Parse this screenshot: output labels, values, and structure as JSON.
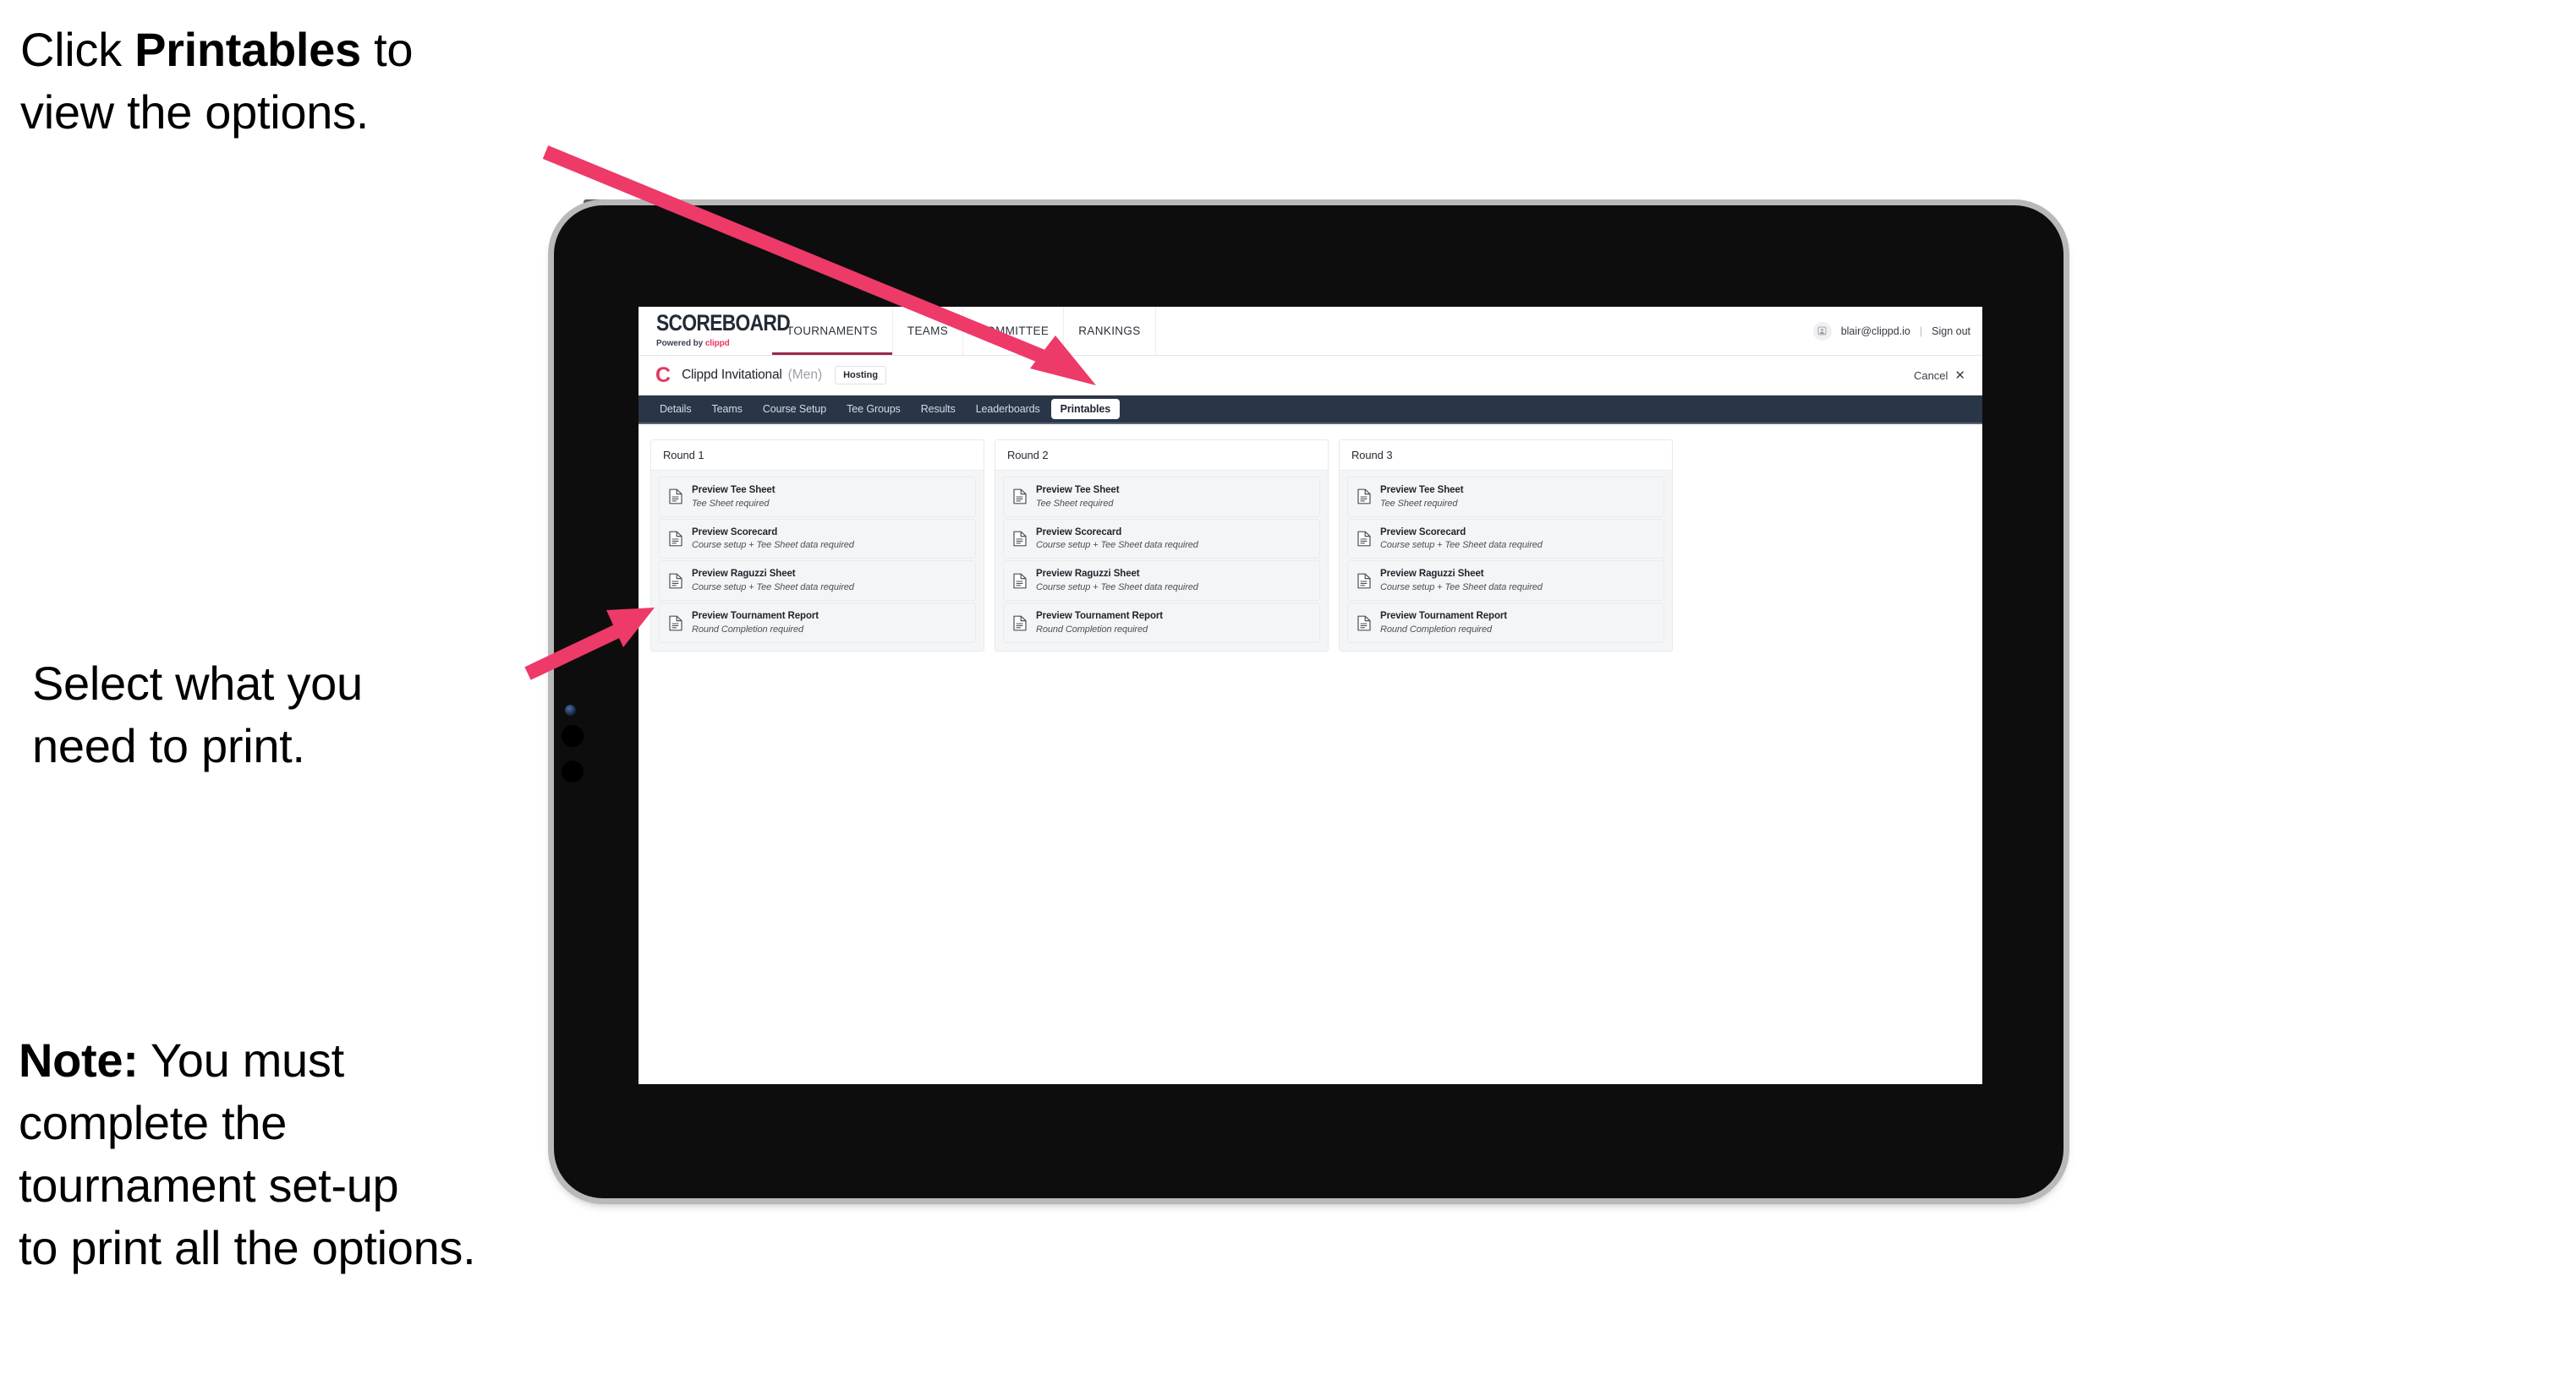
{
  "annotations": {
    "printables_prefix": "Click ",
    "printables_bold": "Printables",
    "printables_suffix": " to\nview the options.",
    "select_text": "Select what you\n need to print.",
    "note_bold": "Note:",
    "note_text": " You must\ncomplete the\ntournament set-up\nto print all the options.",
    "arrow_color": "#ED3A68"
  },
  "app": {
    "brand": {
      "title": "SCOREBOARD",
      "powered_prefix": "Powered by ",
      "powered_brand": "clippd"
    },
    "nav": [
      {
        "label": "TOURNAMENTS",
        "active": true
      },
      {
        "label": "TEAMS",
        "active": false
      },
      {
        "label": "COMMITTEE",
        "active": false
      },
      {
        "label": "RANKINGS",
        "active": false
      }
    ],
    "user": {
      "avatar_icon": "user-avatar-icon",
      "email": "blair@clippd.io",
      "separator": "|",
      "sign_out": "Sign out"
    },
    "tournament": {
      "logo_letter": "C",
      "name": "Clippd Invitational",
      "gender": "(Men)",
      "badge": "Hosting",
      "cancel_label": "Cancel",
      "cancel_icon": "close-icon"
    },
    "subnav": [
      {
        "label": "Details",
        "active": false
      },
      {
        "label": "Teams",
        "active": false
      },
      {
        "label": "Course Setup",
        "active": false
      },
      {
        "label": "Tee Groups",
        "active": false
      },
      {
        "label": "Results",
        "active": false
      },
      {
        "label": "Leaderboards",
        "active": false
      },
      {
        "label": "Printables",
        "active": true
      }
    ],
    "rounds": [
      {
        "header": "Round 1",
        "items": [
          {
            "icon": "document-icon",
            "title": "Preview Tee Sheet",
            "subtitle": "Tee Sheet required"
          },
          {
            "icon": "document-icon",
            "title": "Preview Scorecard",
            "subtitle": "Course setup + Tee Sheet data required"
          },
          {
            "icon": "document-icon",
            "title": "Preview Raguzzi Sheet",
            "subtitle": "Course setup + Tee Sheet data required"
          },
          {
            "icon": "document-icon",
            "title": "Preview Tournament Report",
            "subtitle": "Round Completion required"
          }
        ]
      },
      {
        "header": "Round 2",
        "items": [
          {
            "icon": "document-icon",
            "title": "Preview Tee Sheet",
            "subtitle": "Tee Sheet required"
          },
          {
            "icon": "document-icon",
            "title": "Preview Scorecard",
            "subtitle": "Course setup + Tee Sheet data required"
          },
          {
            "icon": "document-icon",
            "title": "Preview Raguzzi Sheet",
            "subtitle": "Course setup + Tee Sheet data required"
          },
          {
            "icon": "document-icon",
            "title": "Preview Tournament Report",
            "subtitle": "Round Completion required"
          }
        ]
      },
      {
        "header": "Round 3",
        "items": [
          {
            "icon": "document-icon",
            "title": "Preview Tee Sheet",
            "subtitle": "Tee Sheet required"
          },
          {
            "icon": "document-icon",
            "title": "Preview Scorecard",
            "subtitle": "Course setup + Tee Sheet data required"
          },
          {
            "icon": "document-icon",
            "title": "Preview Raguzzi Sheet",
            "subtitle": "Course setup + Tee Sheet data required"
          },
          {
            "icon": "document-icon",
            "title": "Preview Tournament Report",
            "subtitle": "Round Completion required"
          }
        ]
      }
    ],
    "colors": {
      "subnav_bg": "#2A3548",
      "brand_pink": "#E8375F",
      "active_nav_underline": "#9E2846"
    }
  }
}
